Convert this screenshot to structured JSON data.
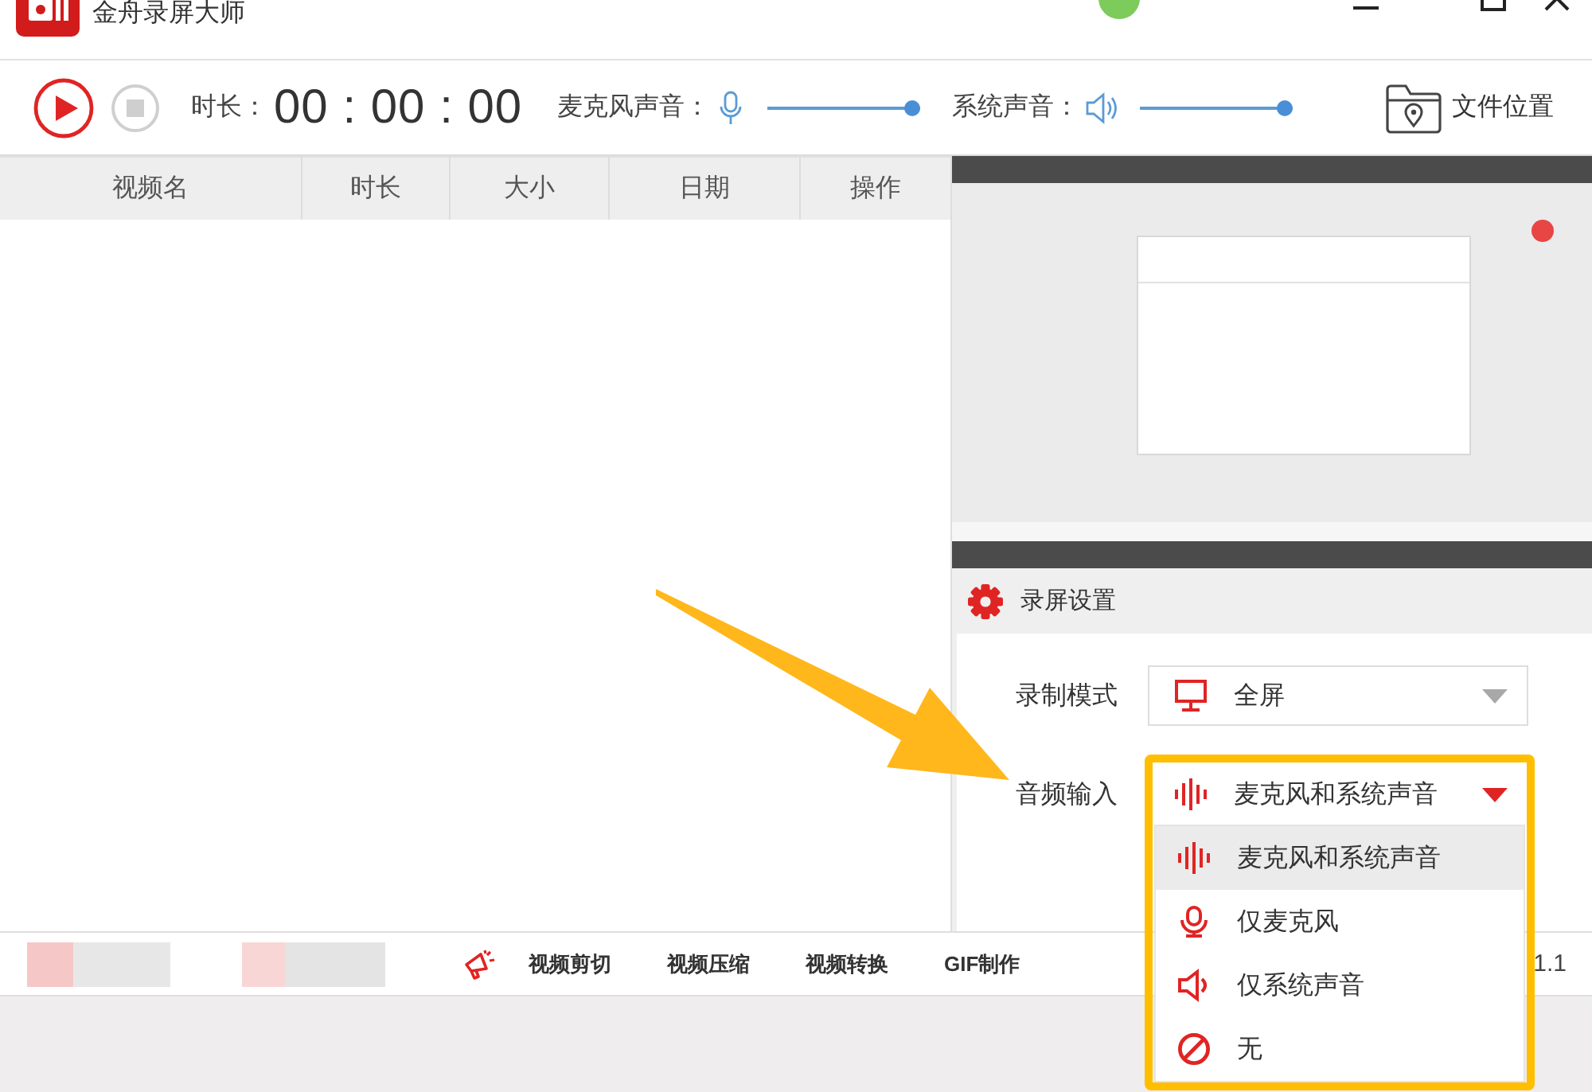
{
  "window": {
    "title": "金舟录屏大师"
  },
  "toolbar": {
    "duration_label": "时长：",
    "duration": "00 : 00 : 00",
    "mic_label": "麦克风声音：",
    "mic_volume": {
      "level": 1
    },
    "system_label": "系统声音：",
    "system_volume": {
      "level": 1
    },
    "file_location": "文件位置"
  },
  "table": {
    "columns": [
      "视频名",
      "时长",
      "大小",
      "日期",
      "操作"
    ]
  },
  "settings": {
    "title": "录屏设置",
    "fields": [
      {
        "label": "录制模式",
        "kind": "screen",
        "value": "全屏",
        "expanded": false
      },
      {
        "label": "音频输入",
        "kind": "both",
        "value": "麦克风和系统声音",
        "expanded": true,
        "options": [
          {
            "kind": "both",
            "label": "麦克风和系统声音",
            "selected": true
          },
          {
            "kind": "mic",
            "label": "仅麦克风",
            "selected": false
          },
          {
            "kind": "speaker",
            "label": "仅系统声音",
            "selected": false
          },
          {
            "kind": "none",
            "label": "无",
            "selected": false
          }
        ]
      }
    ]
  },
  "bottom_bar": {
    "tools": [
      "视频剪切",
      "视频压缩",
      "视频转换",
      "GIF制作"
    ],
    "version": "1.1"
  }
}
